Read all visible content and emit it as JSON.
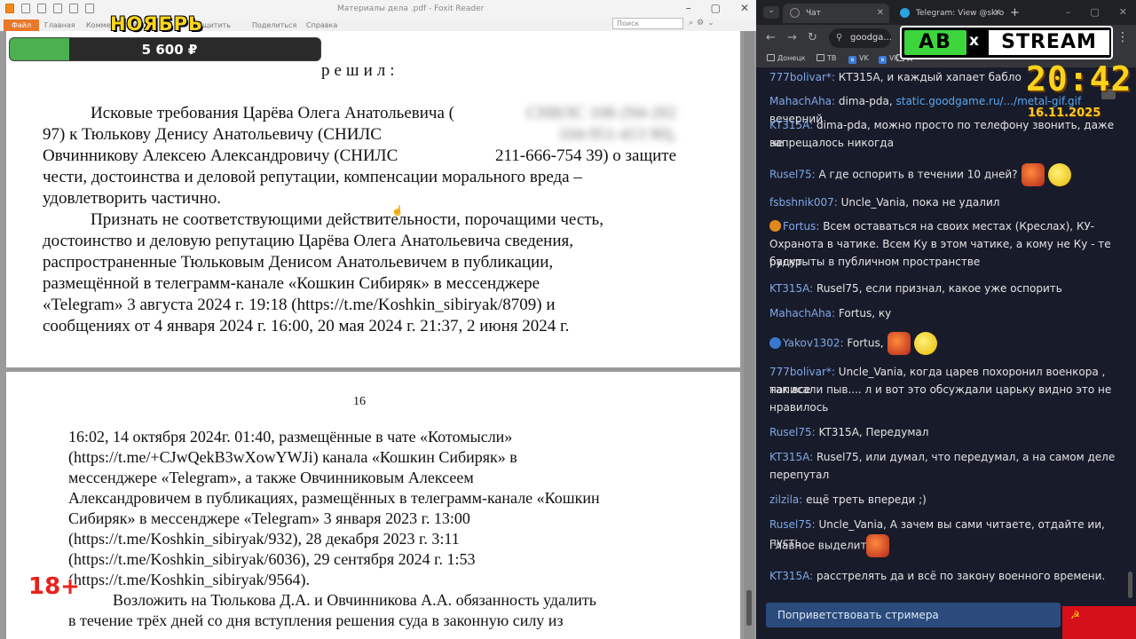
{
  "foxit": {
    "window_title": "Материалы дела .pdf - Foxit Reader",
    "menu": [
      "Файл",
      "Главная",
      "Комментировать",
      "Защитить",
      "Поделиться",
      "Справка"
    ],
    "search_placeholder": "Поиск",
    "page1": {
      "decision": "решил:",
      "lines": [
        [
          "Исковые требования Царёва Олега Анатольевича (",
          "СНИЛС 108-294-202"
        ],
        [
          "97) к Тюлькову Денису Анатольевичу (СНИЛС",
          "104-951-413 90),"
        ],
        [
          "Овчинникову Алексею Александровичу (СНИЛС",
          "211-666-754 39) о защите"
        ],
        [
          "чести, достоинства и деловой репутации, компенсации морального вреда –"
        ],
        [
          "удовлетворить частично."
        ],
        [
          "Признать не соответствующими действительности, порочащими честь,"
        ],
        [
          "достоинство и деловую репутацию Царёва Олега Анатольевича сведения,"
        ],
        [
          "распространенные Тюльковым Денисом Анатольевичем в публикации,"
        ],
        [
          "размещённой в телеграмм-канале «Кошкин Сибиряк» в мессенджере"
        ],
        [
          "«Telegram» 3 августа 2024 г. 19:18 (https://t.me/Koshkin_sibiryak/8709) и"
        ],
        [
          "сообщениях от 4 января 2024 г. 16:00, 20 мая 2024 г. 21:37, 2 июня 2024 г."
        ]
      ]
    },
    "page2": {
      "page_number": "16",
      "lines": [
        "16:02, 14 октября 2024г. 01:40, размещённые в чате «Котомысли»",
        "(https://t.me/+CJwQekB3wXowYWJi) канала «Кошкин Сибиряк» в",
        "мессенджере «Telegram», а также Овчинниковым Алексеем",
        "Александровичем в публикациях, размещённых в телеграмм-канале «Кошкин",
        "Сибиряк» в мессенджере «Telegram» 3 января 2023 г. 13:00",
        "(https://t.me/Koshkin_sibiryak/932), 28 декабря 2023 г. 3:11",
        "(https://t.me/Koshkin_sibiryak/6036), 29 сентября 2024 г. 1:53",
        "(https://t.me/Koshkin_sibiryak/9564).",
        "Возложить на Тюлькова Д.А. и Овчинникова А.А. обязанность удалить",
        "в течение трёх дней со дня вступления решения суда в законную силу из"
      ]
    }
  },
  "overlays": {
    "month": "НОЯБРЬ",
    "donation_amount": "5 600 ₽",
    "donation_progress": 0.19,
    "age_rating": "18+",
    "clock": "20:42",
    "date": "16.11.2025",
    "logo_left": "AB",
    "logo_x": "x",
    "logo_right": "STREAM"
  },
  "chrome": {
    "tabs": [
      {
        "label": "Чат",
        "active": true
      },
      {
        "label": "Telegram: View @skro",
        "active": false
      }
    ],
    "address": "goodga...",
    "bookmarks": [
      "Донецк",
      "ТВ",
      "VK",
      "VK",
      "Д"
    ],
    "accent": "#2b4b7c"
  },
  "chat": {
    "messages": [
      {
        "nick": "777bolivar*:",
        "text": "КТ315А, и каждый хапает бабло"
      },
      {
        "nick": "MahachAha:",
        "text": "dima-pda,",
        "link": "static.goodgame.ru/.../metal-gif.gif",
        "tail": "вечерний"
      },
      {
        "nick": "KT315A:",
        "text": "dima-pda, можно просто по телефону звонить, даже не"
      },
      {
        "cont": "запрещалось никогда"
      },
      {
        "nick": "Rusel75:",
        "text": "А где оспорить в течении 10 дней?"
      },
      {
        "nick": "fsbshnik007:",
        "text": "Uncle_Vania, пока не удалил"
      },
      {
        "nick": "Fortus:",
        "text": "Всем оставаться на своих местах (Креслах), КУ-"
      },
      {
        "cont": "Охранота в чатике. Всем Ку в этом чатике, а кому не Ку - те будут"
      },
      {
        "cont": "раскрыты в публичном пространстве"
      },
      {
        "nick": "KT315A:",
        "text": "Rusel75, если признал, какое уже оспорить"
      },
      {
        "nick": "MahachAha:",
        "text": "Fortus, ку"
      },
      {
        "nick": "Yakov1302:",
        "text": "Fortus,"
      },
      {
        "nick": "777bolivar*:",
        "text": "Uncle_Vania, когда царев похоронил военкора , так все"
      },
      {
        "cont": "написали пыв.... л и вот это обсуждали царьку видно это не"
      },
      {
        "cont": "нравилось"
      },
      {
        "nick": "Rusel75:",
        "text": "KT315A, Передумал"
      },
      {
        "nick": "KT315A:",
        "text": "Rusel75, или думал, что передумал, а на самом деле"
      },
      {
        "cont": "перепутал"
      },
      {
        "nick": "zilzila:",
        "text": "ещё треть впереди ;)"
      },
      {
        "nick": "Rusel75:",
        "text": "Uncle_Vania, А зачем вы сами читаете, отдайте ии, пусть"
      },
      {
        "cont": "главное выделит"
      },
      {
        "nick": "KT315A:",
        "text": "расстрелять да и всё по закону военного времени."
      }
    ],
    "greet_button": "Поприветствовать стримера"
  }
}
